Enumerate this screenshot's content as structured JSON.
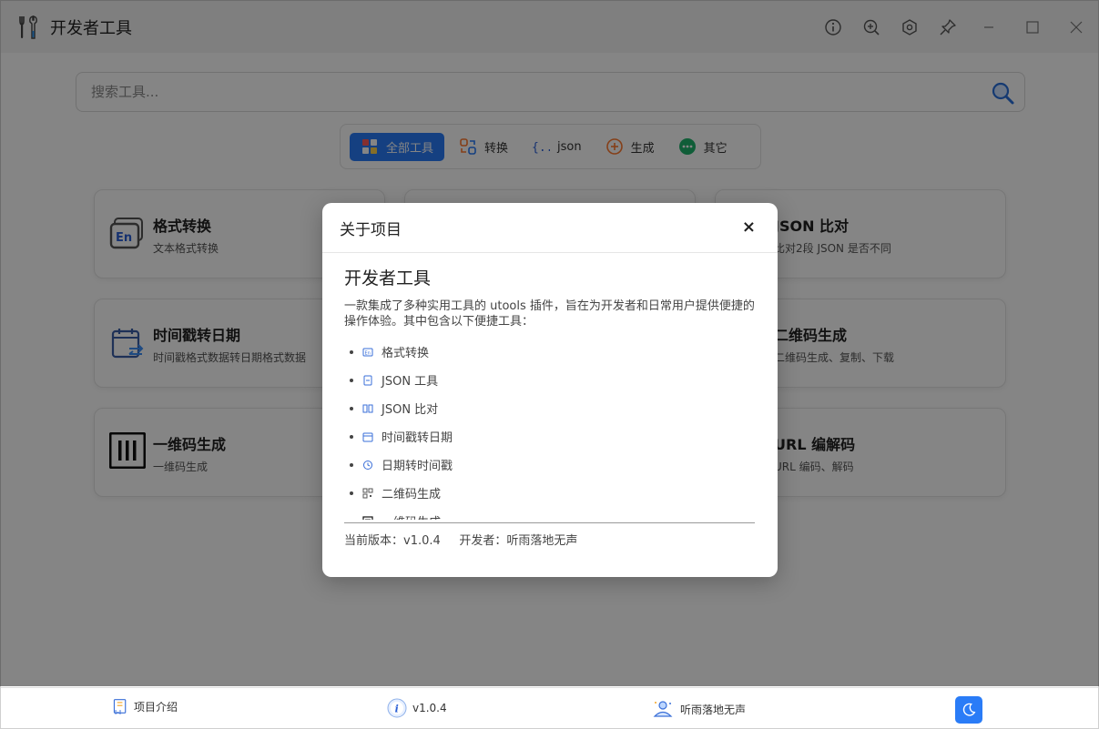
{
  "app": {
    "title": "开发者工具"
  },
  "search": {
    "placeholder": "搜索工具..."
  },
  "filters": [
    {
      "label": "全部工具",
      "icon": "grid-icon",
      "active": true
    },
    {
      "label": "转换",
      "icon": "swap-icon",
      "active": false
    },
    {
      "label": "json",
      "icon": "json-braces-icon",
      "active": false
    },
    {
      "label": "生成",
      "icon": "plus-circle-icon",
      "active": false
    },
    {
      "label": "其它",
      "icon": "more-dots-icon",
      "active": false
    }
  ],
  "cards": [
    {
      "title": "格式转换",
      "desc": "文本格式转换",
      "icon": "format-convert-icon"
    },
    {
      "title": "JSON 比对",
      "desc": "比对2段 JSON 是否不同",
      "icon": "json-compare-icon"
    },
    {
      "title": "时间戳转日期",
      "desc": "时间戳格式数据转日期格式数据",
      "icon": "calendar-swap-icon"
    },
    {
      "title": "二维码生成",
      "desc": "二维码生成、复制、下载",
      "icon": "qrcode-icon"
    },
    {
      "title": "一维码生成",
      "desc": "一维码生成",
      "icon": "barcode-icon"
    },
    {
      "title": "URL 编解码",
      "desc": "URL 编码、解码",
      "icon": "url-icon"
    }
  ],
  "modal": {
    "title": "关于项目",
    "close": "×",
    "heading": "开发者工具",
    "intro": "一款集成了多种实用工具的 utools 插件，旨在为开发者和日常用户提供便捷的操作体验。其中包含以下便捷工具：",
    "tools": [
      {
        "label": "格式转换",
        "icon": "format-convert-icon"
      },
      {
        "label": "JSON 工具",
        "icon": "json-file-icon"
      },
      {
        "label": "JSON 比对",
        "icon": "json-compare-icon"
      },
      {
        "label": "时间戳转日期",
        "icon": "calendar-swap-icon"
      },
      {
        "label": "日期转时间戳",
        "icon": "clock-icon"
      },
      {
        "label": "二维码生成",
        "icon": "qrcode-icon"
      },
      {
        "label": "一维码生成",
        "icon": "barcode-icon"
      }
    ],
    "footer": "当前版本：v1.0.4     开发者：听雨落地无声"
  },
  "bottom": {
    "intro_label": "项目介绍",
    "version_label": "v1.0.4",
    "author_label": "听雨落地无声"
  },
  "colors": {
    "accent": "#2a7cf7",
    "overlay": "rgba(0,0,0,0.48)"
  }
}
